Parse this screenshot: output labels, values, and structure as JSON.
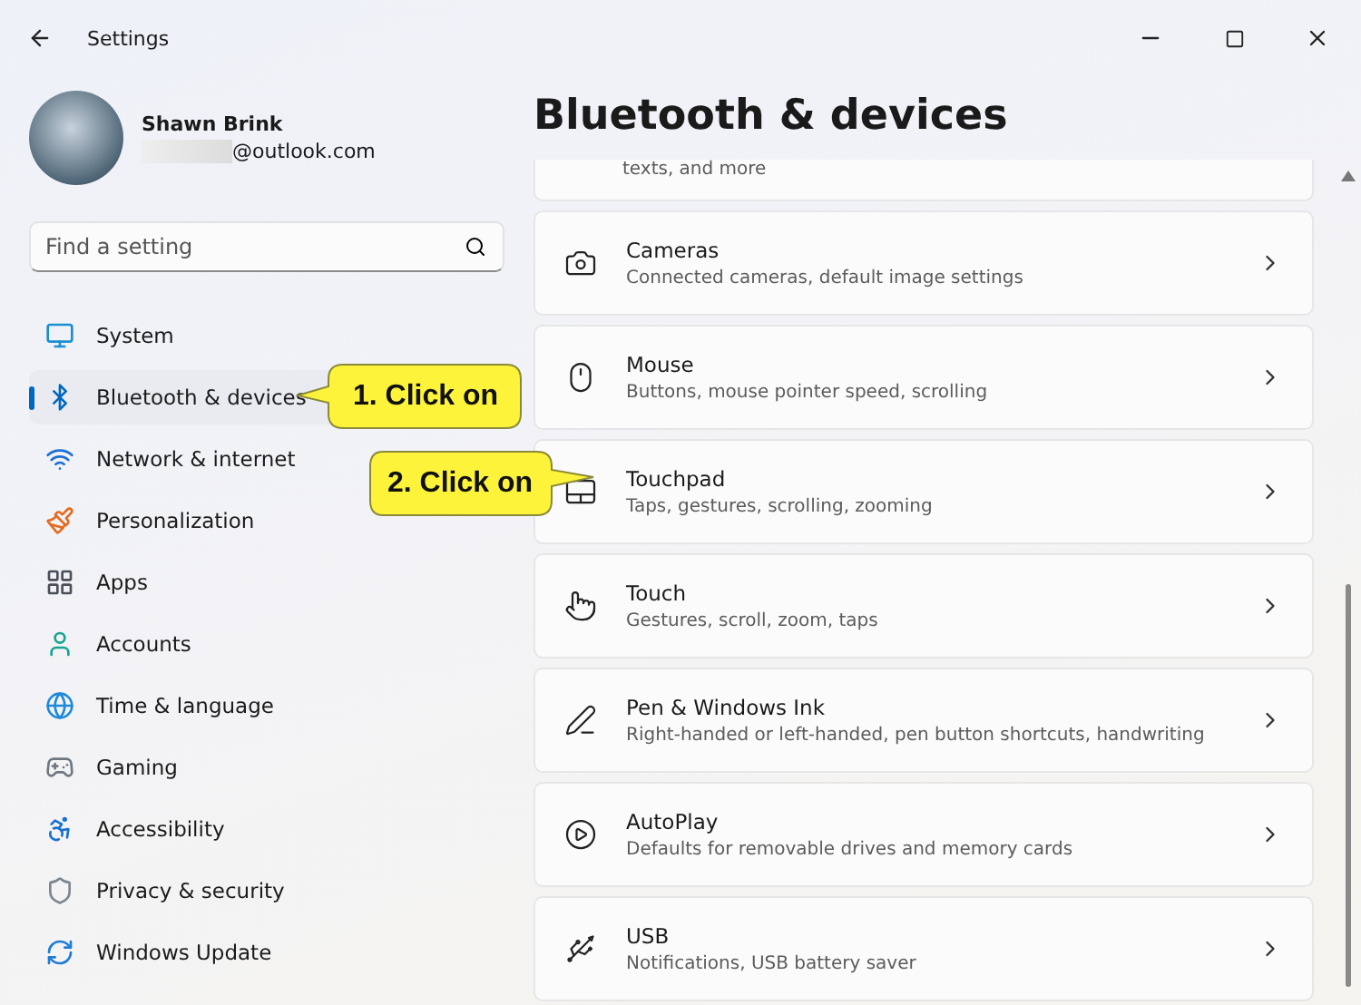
{
  "window": {
    "title": "Settings"
  },
  "profile": {
    "name": "Shawn Brink",
    "email": "@outlook.com"
  },
  "search": {
    "placeholder": "Find a setting"
  },
  "nav": [
    {
      "label": "System",
      "selected": false
    },
    {
      "label": "Bluetooth & devices",
      "selected": true
    },
    {
      "label": "Network & internet",
      "selected": false
    },
    {
      "label": "Personalization",
      "selected": false
    },
    {
      "label": "Apps",
      "selected": false
    },
    {
      "label": "Accounts",
      "selected": false
    },
    {
      "label": "Time & language",
      "selected": false
    },
    {
      "label": "Gaming",
      "selected": false
    },
    {
      "label": "Accessibility",
      "selected": false
    },
    {
      "label": "Privacy & security",
      "selected": false
    },
    {
      "label": "Windows Update",
      "selected": false
    }
  ],
  "page": {
    "title": "Bluetooth & devices",
    "partial_card": "texts, and more",
    "cards": [
      {
        "title": "Cameras",
        "description": "Connected cameras, default image settings"
      },
      {
        "title": "Mouse",
        "description": "Buttons, mouse pointer speed, scrolling"
      },
      {
        "title": "Touchpad",
        "description": "Taps, gestures, scrolling, zooming"
      },
      {
        "title": "Touch",
        "description": "Gestures, scroll, zoom, taps"
      },
      {
        "title": "Pen & Windows Ink",
        "description": "Right-handed or left-handed, pen button shortcuts, handwriting"
      },
      {
        "title": "AutoPlay",
        "description": "Defaults for removable drives and memory cards"
      },
      {
        "title": "USB",
        "description": "Notifications, USB battery saver"
      }
    ]
  },
  "callouts": [
    {
      "text": "1. Click on"
    },
    {
      "text": "2. Click on"
    }
  ]
}
